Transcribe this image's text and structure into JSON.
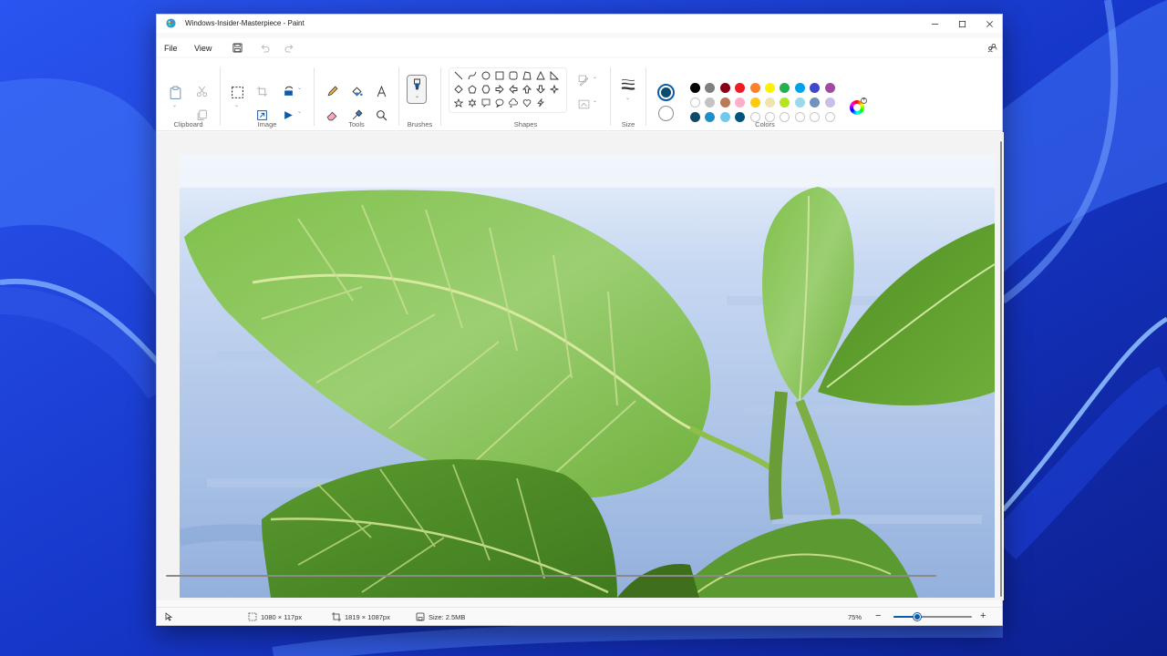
{
  "window": {
    "title": "Windows-Insider-Masterpiece - Paint"
  },
  "menu": {
    "file": "File",
    "view": "View"
  },
  "ribbon": {
    "groups": {
      "clipboard": "Clipboard",
      "image": "Image",
      "tools": "Tools",
      "brushes": "Brushes",
      "shapes": "Shapes",
      "size": "Size",
      "colors": "Colors"
    }
  },
  "colors": {
    "primary": "#0b4a6b",
    "secondary": "#ffffff",
    "palette_row1": [
      "#000000",
      "#7f7f7f",
      "#880015",
      "#ed1c24",
      "#ff7f27",
      "#fff200",
      "#22b14c",
      "#00a2e8",
      "#3f48cc",
      "#a349a4"
    ],
    "palette_row2": [
      "#ffffff",
      "#c3c3c3",
      "#b97a57",
      "#ffaec9",
      "#ffc90e",
      "#efe4b0",
      "#b5e61d",
      "#99d9ea",
      "#7092be",
      "#c8bfe7"
    ],
    "palette_row3": [
      "#0b4a6b",
      "#1e90c8",
      "#6fc8ee",
      "#00557f",
      "",
      "",
      "",
      "",
      "",
      ""
    ]
  },
  "status": {
    "selection_size": "1080 × 117px",
    "canvas_size": "1819 × 1087px",
    "file_size": "Size: 2.5MB",
    "zoom": "75%",
    "zoom_level": 0.3
  }
}
